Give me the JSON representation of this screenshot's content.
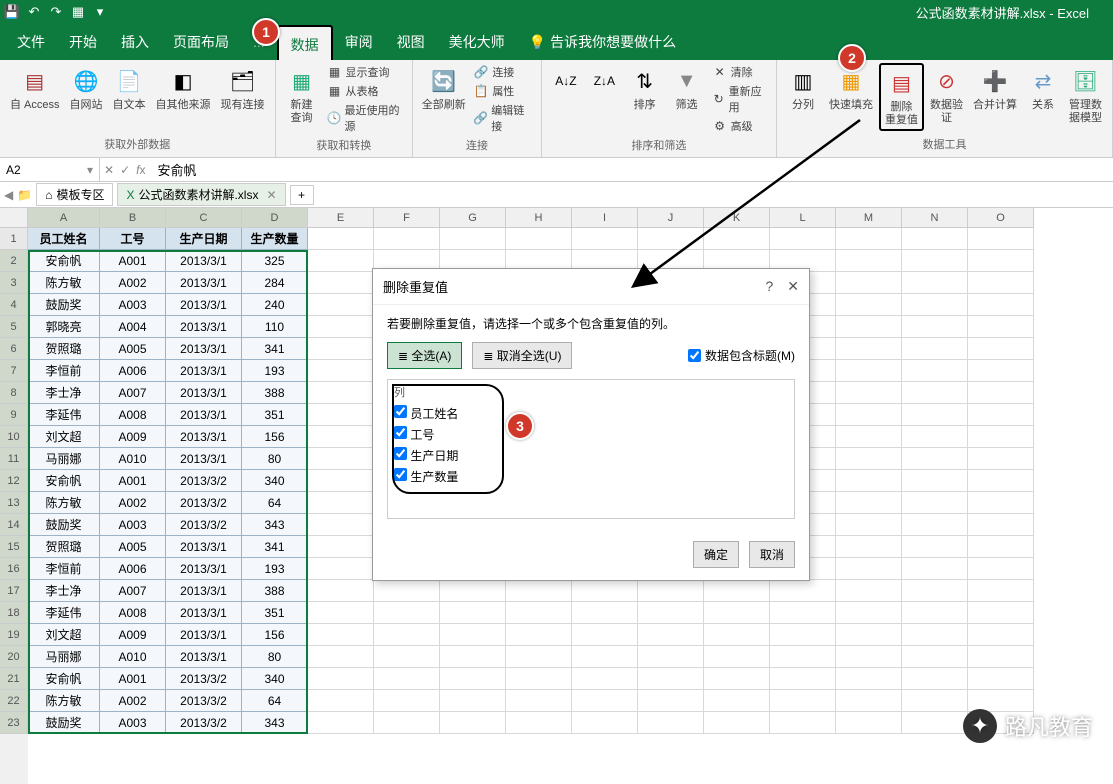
{
  "app": {
    "title": "公式函数素材讲解.xlsx - Excel"
  },
  "qat": [
    "save-icon",
    "undo-icon",
    "redo-icon",
    "table-icon",
    "dropdown-icon"
  ],
  "tabs": [
    "文件",
    "开始",
    "插入",
    "页面布局",
    "...",
    "数据",
    "审阅",
    "视图",
    "美化大师"
  ],
  "tellme": "告诉我你想要做什么",
  "ribbon_groups": {
    "ext_data": {
      "label": "获取外部数据",
      "items": [
        "自 Access",
        "自网站",
        "自文本",
        "自其他来源",
        "现有连接"
      ]
    },
    "get_transform": {
      "label": "获取和转换",
      "main": "新建\n查询",
      "sub": [
        "显示查询",
        "从表格",
        "最近使用的源"
      ]
    },
    "connections": {
      "label": "连接",
      "main": "全部刷新",
      "sub": [
        "连接",
        "属性",
        "编辑链接"
      ]
    },
    "sort": {
      "label": "排序和筛选",
      "btns": [
        "排序",
        "筛选"
      ],
      "sub": [
        "清除",
        "重新应用",
        "高级"
      ]
    },
    "data_tools": {
      "label": "数据工具",
      "items": [
        "分列",
        "快速填充",
        "删除\n重复值",
        "数据验\n证",
        "合并计算",
        "关系",
        "管理数\n据模型"
      ]
    }
  },
  "namebox": "A2",
  "formula": "安俞帆",
  "file_tabs": [
    "模板专区",
    "公式函数素材讲解.xlsx"
  ],
  "col_widths": {
    "A": 72,
    "B": 66,
    "C": 76,
    "D": 66,
    "rest": 66
  },
  "columns": [
    "A",
    "B",
    "C",
    "D",
    "E",
    "F",
    "G",
    "H",
    "I",
    "J",
    "K",
    "L",
    "M",
    "N",
    "O"
  ],
  "chart_data": {
    "type": "table",
    "headers": [
      "员工姓名",
      "工号",
      "生产日期",
      "生产数量"
    ],
    "rows": [
      [
        "安俞帆",
        "A001",
        "2013/3/1",
        "325"
      ],
      [
        "陈方敏",
        "A002",
        "2013/3/1",
        "284"
      ],
      [
        "鼓励奖",
        "A003",
        "2013/3/1",
        "240"
      ],
      [
        "郭晓亮",
        "A004",
        "2013/3/1",
        "110"
      ],
      [
        "贺照璐",
        "A005",
        "2013/3/1",
        "341"
      ],
      [
        "李恒前",
        "A006",
        "2013/3/1",
        "193"
      ],
      [
        "李士净",
        "A007",
        "2013/3/1",
        "388"
      ],
      [
        "李延伟",
        "A008",
        "2013/3/1",
        "351"
      ],
      [
        "刘文超",
        "A009",
        "2013/3/1",
        "156"
      ],
      [
        "马丽娜",
        "A010",
        "2013/3/1",
        "80"
      ],
      [
        "安俞帆",
        "A001",
        "2013/3/2",
        "340"
      ],
      [
        "陈方敏",
        "A002",
        "2013/3/2",
        "64"
      ],
      [
        "鼓励奖",
        "A003",
        "2013/3/2",
        "343"
      ],
      [
        "贺照璐",
        "A005",
        "2013/3/1",
        "341"
      ],
      [
        "李恒前",
        "A006",
        "2013/3/1",
        "193"
      ],
      [
        "李士净",
        "A007",
        "2013/3/1",
        "388"
      ],
      [
        "李延伟",
        "A008",
        "2013/3/1",
        "351"
      ],
      [
        "刘文超",
        "A009",
        "2013/3/1",
        "156"
      ],
      [
        "马丽娜",
        "A010",
        "2013/3/1",
        "80"
      ],
      [
        "安俞帆",
        "A001",
        "2013/3/2",
        "340"
      ],
      [
        "陈方敏",
        "A002",
        "2013/3/2",
        "64"
      ],
      [
        "鼓励奖",
        "A003",
        "2013/3/2",
        "343"
      ]
    ]
  },
  "dialog": {
    "title": "删除重复值",
    "desc": "若要删除重复值，请选择一个或多个包含重复值的列。",
    "select_all": "全选(A)",
    "deselect_all": "取消全选(U)",
    "header_opt": "数据包含标题(M)",
    "col_label": "列",
    "cols": [
      "员工姓名",
      "工号",
      "生产日期",
      "生产数量"
    ],
    "ok": "确定",
    "cancel": "取消"
  },
  "callouts": {
    "1": "1",
    "2": "2",
    "3": "3"
  },
  "watermark": "路凡教育"
}
